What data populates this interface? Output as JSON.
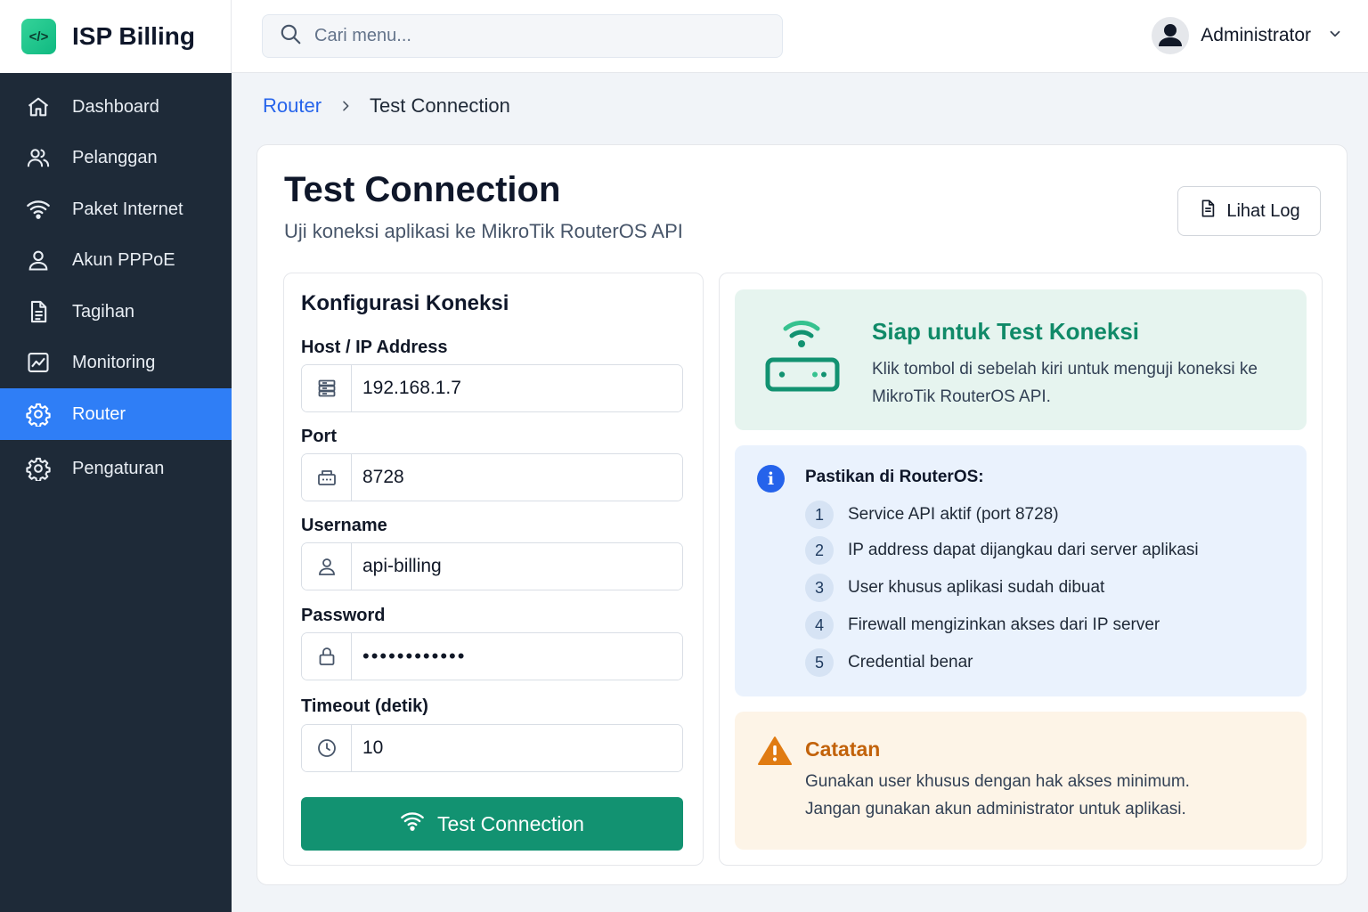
{
  "app": {
    "brand_name": "ISP Billing",
    "logo_glyph": "</>"
  },
  "search": {
    "placeholder": "Cari menu..."
  },
  "user": {
    "name": "Administrator"
  },
  "sidebar": {
    "items": [
      {
        "label": "Dashboard",
        "icon": "home-icon"
      },
      {
        "label": "Pelanggan",
        "icon": "users-icon"
      },
      {
        "label": "Paket Internet",
        "icon": "wifi-icon"
      },
      {
        "label": "Akun PPPoE",
        "icon": "user-icon"
      },
      {
        "label": "Tagihan",
        "icon": "document-icon"
      },
      {
        "label": "Monitoring",
        "icon": "chart-icon"
      },
      {
        "label": "Router",
        "icon": "gear-icon",
        "active": true
      },
      {
        "label": "Pengaturan",
        "icon": "gear-icon"
      }
    ]
  },
  "breadcrumb": {
    "parent": "Router",
    "current": "Test Connection"
  },
  "page": {
    "title": "Test Connection",
    "subtitle": "Uji koneksi aplikasi ke MikroTik RouterOS API",
    "log_button": "Lihat Log"
  },
  "form": {
    "title": "Konfigurasi Koneksi",
    "host": {
      "label": "Host / IP Address",
      "value": "192.168.1.7"
    },
    "port": {
      "label": "Port",
      "value": "8728"
    },
    "username": {
      "label": "Username",
      "value": "api-billing"
    },
    "password": {
      "label": "Password",
      "value": "••••••••••••"
    },
    "timeout": {
      "label": "Timeout (detik)",
      "value": "10"
    },
    "submit_label": "Test Connection"
  },
  "status": {
    "title": "Siap untuk Test Koneksi",
    "text": "Klik tombol di sebelah kiri untuk menguji koneksi ke MikroTik RouterOS API."
  },
  "checklist": {
    "title": "Pastikan di RouterOS:",
    "items": [
      {
        "num": "1",
        "text": "Service API aktif (port 8728)"
      },
      {
        "num": "2",
        "text": "IP address dapat dijangkau dari server aplikasi"
      },
      {
        "num": "3",
        "text": "User khusus aplikasi sudah dibuat"
      },
      {
        "num": "4",
        "text": "Firewall mengizinkan akses dari IP server"
      },
      {
        "num": "5",
        "text": "Credential benar"
      }
    ]
  },
  "note": {
    "title": "Catatan",
    "line1": "Gunakan user khusus dengan hak akses minimum.",
    "line2": "Jangan gunakan akun administrator untuk aplikasi."
  },
  "colors": {
    "sidebar_bg": "#1e2a38",
    "active_nav": "#2f7ef6",
    "primary_green": "#129271",
    "link_blue": "#2563eb",
    "warning": "#c2620a"
  }
}
